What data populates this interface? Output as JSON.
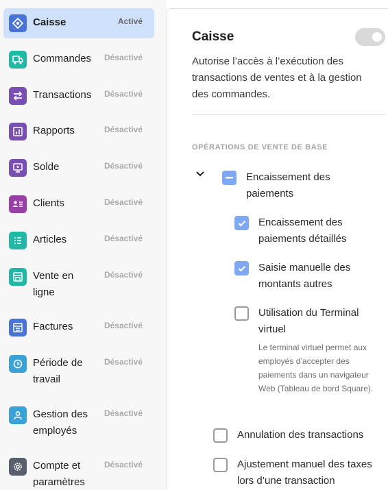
{
  "sidebar": {
    "items": [
      {
        "label": "Caisse",
        "status": "Activé",
        "icon": "register-icon",
        "color": "#4a73d6"
      },
      {
        "label": "Commandes",
        "status": "Désactivé",
        "icon": "truck-icon",
        "color": "#22b8a5"
      },
      {
        "label": "Transactions",
        "status": "Désactivé",
        "icon": "arrows-swap-icon",
        "color": "#7a4fb3"
      },
      {
        "label": "Rapports",
        "status": "Désactivé",
        "icon": "bar-chart-icon",
        "color": "#7a4fb3"
      },
      {
        "label": "Solde",
        "status": "Désactivé",
        "icon": "balance-icon",
        "color": "#7a4fb3"
      },
      {
        "label": "Clients",
        "status": "Désactivé",
        "icon": "contact-card-icon",
        "color": "#9b3fa8"
      },
      {
        "label": "Articles",
        "status": "Désactivé",
        "icon": "list-icon",
        "color": "#22b8a5"
      },
      {
        "label": "Vente en ligne",
        "status": "Désactivé",
        "icon": "storefront-icon",
        "color": "#22b8a5"
      },
      {
        "label": "Factures",
        "status": "Désactivé",
        "icon": "invoice-icon",
        "color": "#4a73d6"
      },
      {
        "label": "Période de travail",
        "status": "Désactivé",
        "icon": "clock-icon",
        "color": "#3ba2d8"
      },
      {
        "label": "Gestion des employés",
        "status": "Désactivé",
        "icon": "person-icon",
        "color": "#3ba2d8"
      },
      {
        "label": "Compte et paramètres",
        "status": "Désactivé",
        "icon": "gear-icon",
        "color": "#5a5f6e"
      }
    ]
  },
  "panel": {
    "title": "Caisse",
    "toggle_on": false,
    "description": "Autorise l’accès à l’exécution des transactions de ventes et à la gestion des commandes.",
    "section_title": "OPÉRATIONS DE VENTE DE BASE",
    "permissions": [
      {
        "label": "Encaissement des paiements",
        "state": "indeterminate"
      },
      {
        "label": "Encaissement des paiements détaillés",
        "state": "checked"
      },
      {
        "label": "Saisie manuelle des montants autres",
        "state": "checked"
      },
      {
        "label": "Utilisation du Terminal virtuel",
        "state": "unchecked",
        "helper": "Le terminal virtuel permet aux employés d’accepter des paiements dans un navigateur Web (Tableau de bord Square)."
      },
      {
        "label": "Annulation des transactions",
        "state": "unchecked"
      },
      {
        "label": "Ajustement manuel des taxes lors d’une transaction",
        "state": "unchecked"
      }
    ],
    "accent_color": "#7ea9f2"
  }
}
